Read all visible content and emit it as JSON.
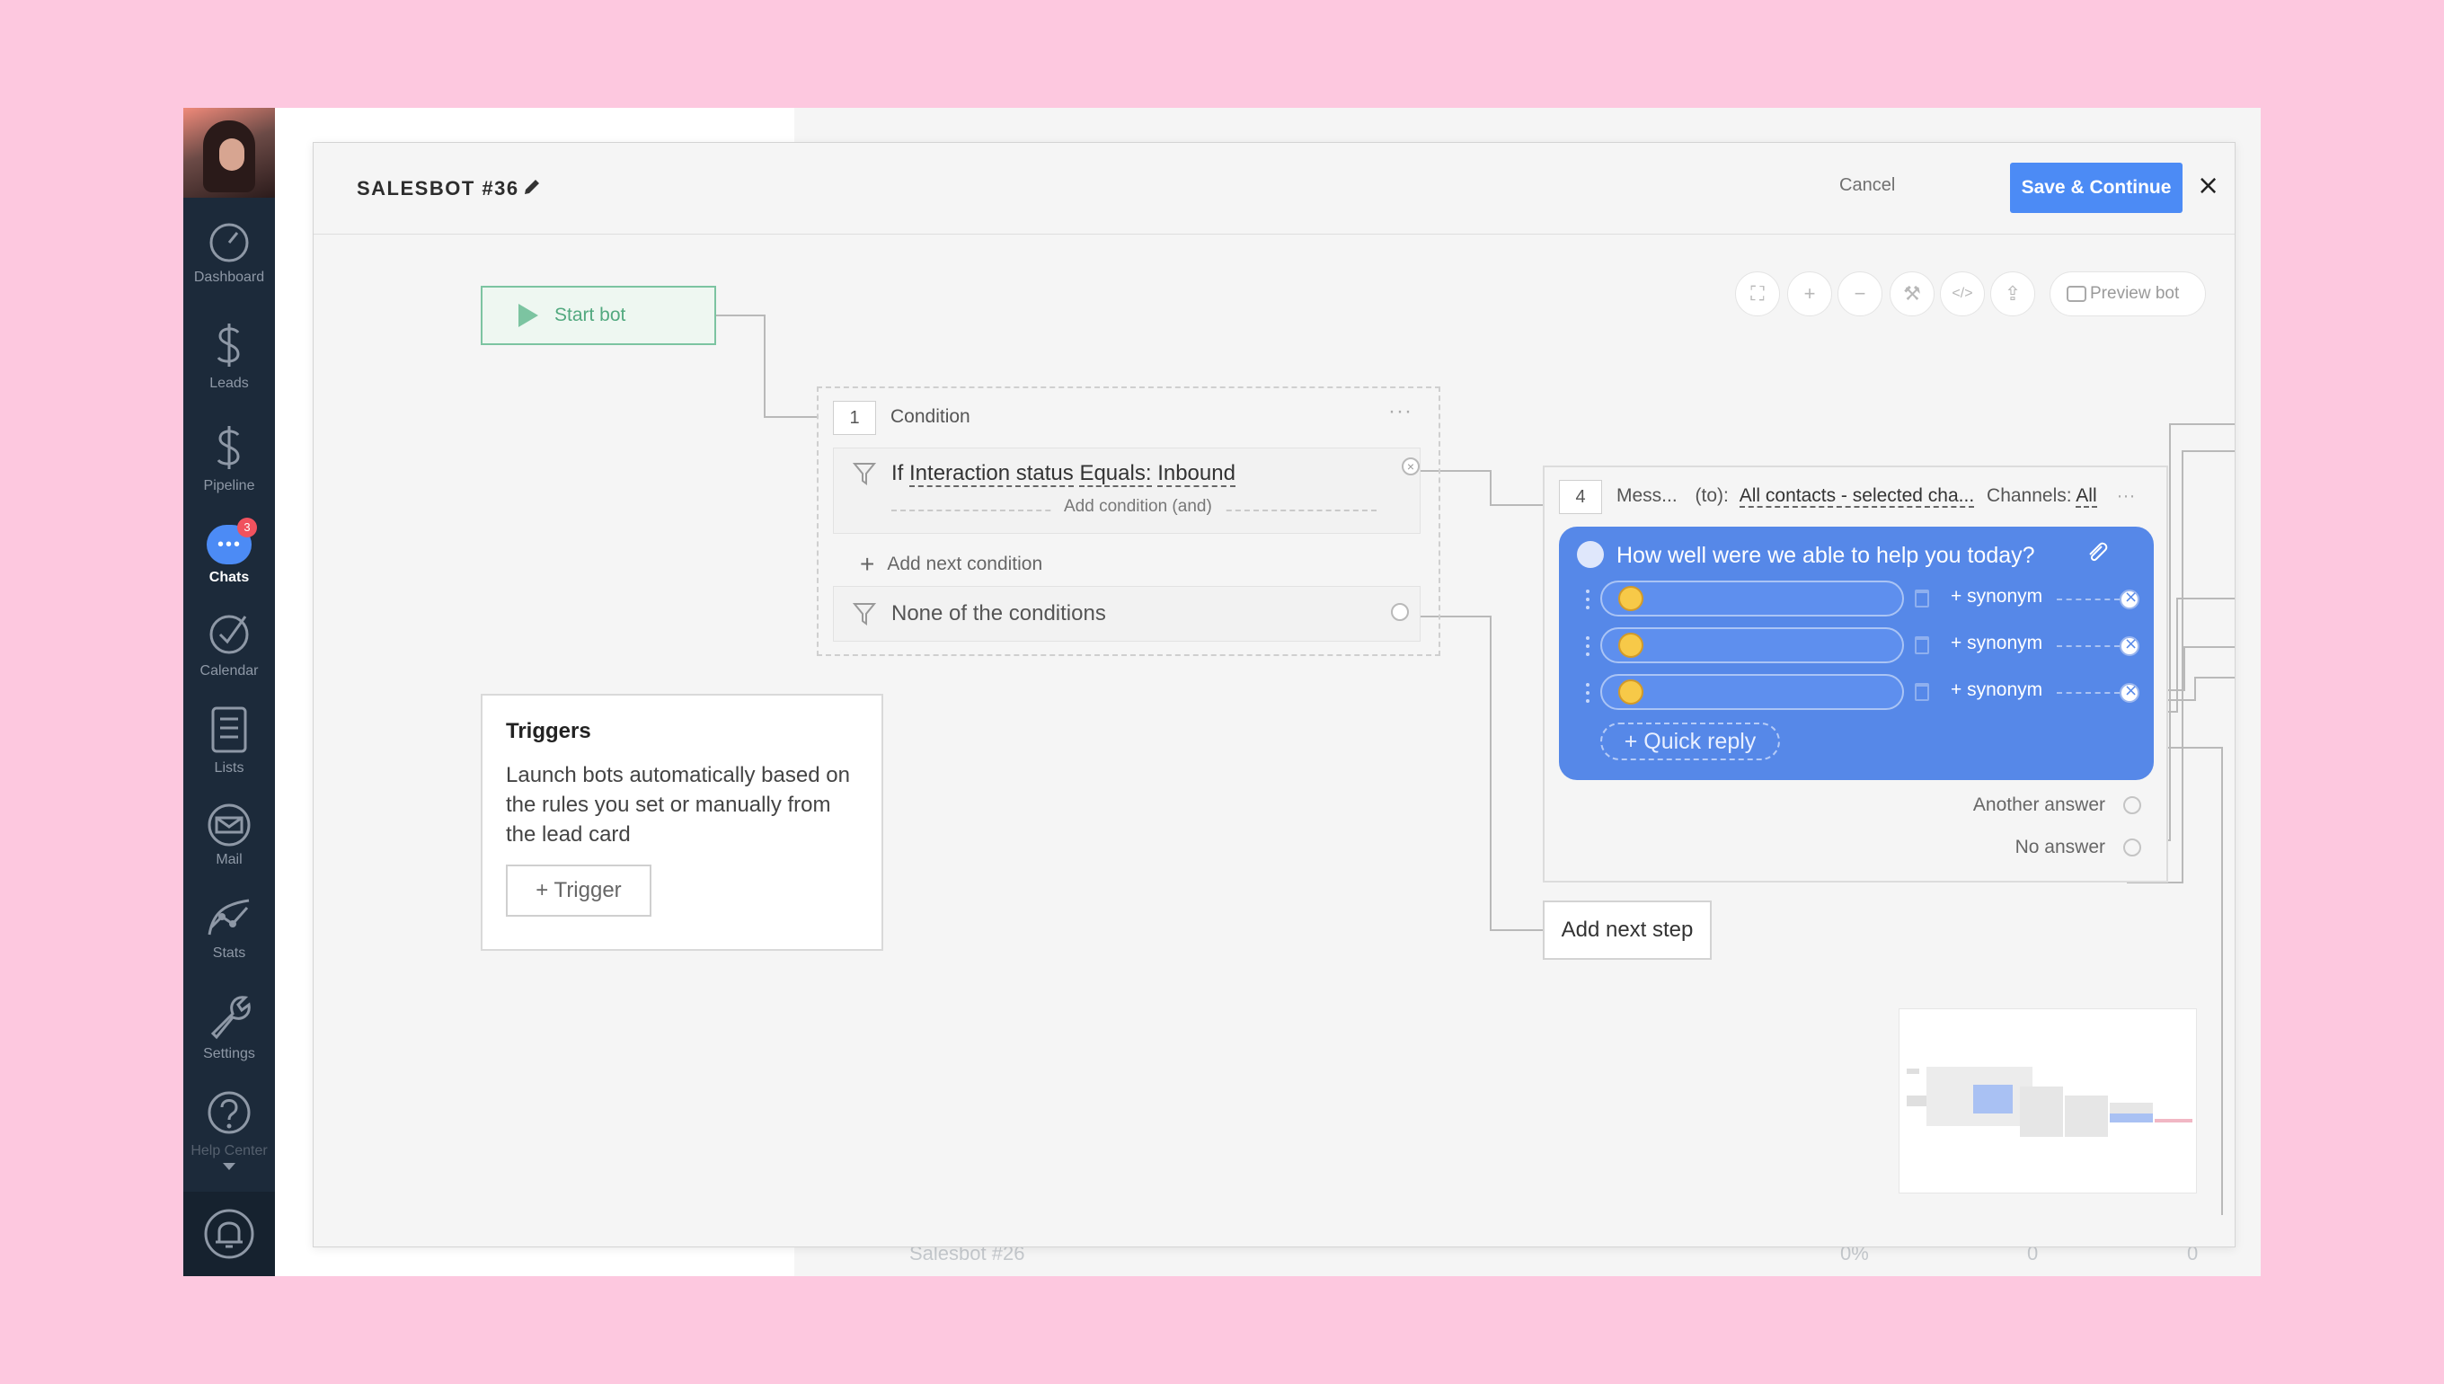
{
  "sidebar": {
    "items": [
      {
        "label": "Dashboard",
        "icon": "dashboard-icon"
      },
      {
        "label": "Leads",
        "icon": "dollar-icon"
      },
      {
        "label": "Pipeline",
        "icon": "dollar-icon"
      },
      {
        "label": "Chats",
        "icon": "chat-bubble-icon",
        "badge": "3"
      },
      {
        "label": "Calendar",
        "icon": "checkmark-icon"
      },
      {
        "label": "Lists",
        "icon": "list-icon"
      },
      {
        "label": "Mail",
        "icon": "mail-icon"
      },
      {
        "label": "Stats",
        "icon": "stats-icon"
      },
      {
        "label": "Settings",
        "icon": "wrench-icon"
      },
      {
        "label": "Help Center",
        "icon": "help-icon"
      }
    ],
    "notifications_icon": "bell-icon"
  },
  "background_list": {
    "row_name": "Salesbot #26",
    "row_pct": "0%",
    "row_v1": "0",
    "row_v2": "0"
  },
  "modal": {
    "title": "SALESBOT #36",
    "cancel_label": "Cancel",
    "save_label": "Save & Continue",
    "close_label": "×"
  },
  "toolbar": {
    "tools": [
      "fullscreen-icon",
      "zoom-in-icon",
      "zoom-out-icon",
      "magic-wand-icon",
      "code-icon",
      "export-icon"
    ],
    "preview_label": "Preview bot"
  },
  "start_bot": {
    "label": "Start bot"
  },
  "condition": {
    "number": "1",
    "title": "Condition",
    "menu": "···",
    "if_prefix": "If ",
    "field": "Interaction status",
    "operator": "Equals:",
    "value": "Inbound",
    "add_and": "Add condition (and)",
    "add_next": "Add next condition",
    "none": "None of the conditions"
  },
  "triggers": {
    "title": "Triggers",
    "description": "Launch bots automatically based on the rules you set or manually from the lead card",
    "button": "+ Trigger"
  },
  "message": {
    "number": "4",
    "title": "Mess...",
    "to_label": "(to):",
    "to_value": "All contacts - selected cha...",
    "channels_label": "Channels:",
    "channels_value": "All",
    "menu": "···",
    "question": "How well were we able to help you today?",
    "replies": [
      {
        "emoji": "frowning-face",
        "synonym": "+ synonym"
      },
      {
        "emoji": "neutral-face",
        "synonym": "+ synonym"
      },
      {
        "emoji": "grinning-face",
        "synonym": "+ synonym"
      }
    ],
    "quick_reply": "+ Quick reply",
    "another_answer": "Another answer",
    "no_answer": "No answer"
  },
  "add_next_step": "Add next step",
  "colors": {
    "accent": "#4c8bf5",
    "sidebar": "#1c2a3a",
    "start_green": "#7cc4a1",
    "message_blue": "#5688e8",
    "page_bg": "#fdc8df"
  }
}
